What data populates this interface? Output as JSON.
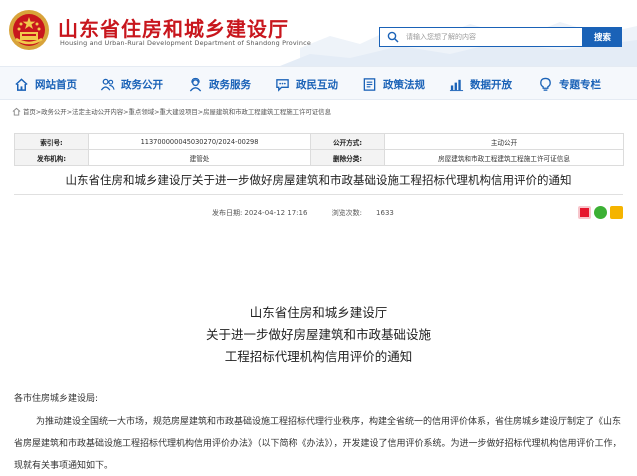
{
  "header": {
    "title": "山东省住房和城乡建设厅",
    "subtitle": "Housing and Urban-Rural Development Department of Shandong Province",
    "search_placeholder": "请输入您想了解的内容",
    "search_button": "搜索"
  },
  "nav": {
    "items": [
      {
        "label": "网站首页",
        "icon": "home-icon"
      },
      {
        "label": "政务公开",
        "icon": "people-icon"
      },
      {
        "label": "政务服务",
        "icon": "service-icon"
      },
      {
        "label": "政民互动",
        "icon": "chat-icon"
      },
      {
        "label": "政策法规",
        "icon": "law-icon"
      },
      {
        "label": "数据开放",
        "icon": "data-icon"
      },
      {
        "label": "专题专栏",
        "icon": "bulb-icon"
      }
    ]
  },
  "breadcrumb": {
    "text": "首页>政务公开>法定主动公开内容>重点领域>重大建设项目>房屋建筑和市政工程建筑工程施工许可证信息"
  },
  "meta": {
    "index_label": "索引号:",
    "index_value": "11370000004503027​0/2024-00298",
    "public_label": "公开方式:",
    "public_value": "主动公开",
    "org_label": "发布机构:",
    "org_value": "建管处",
    "category_label": "删除分类:",
    "category_value": "房屋建筑和市政工程建筑工程施工许可证信息"
  },
  "article": {
    "title": "山东省住房和城乡建设厅关于进一步做好房屋建筑和市政基础设施工程招标代理机构信用评价的通知",
    "date_label": "发布日期:",
    "date_value": "2024-04-12 17:16",
    "views_label": "浏览次数:",
    "views_value": "1633"
  },
  "doc": {
    "head1": "山东省住房和城乡建设厅",
    "head2": "关于进一步做好房屋建筑和市政基础设施",
    "head3": "工程招标代理机构信用评价的通知",
    "salutation": "各市住房城乡建设局:",
    "paragraph": "为推动建设全国统一大市场，规范房屋建筑和市政基础设施工程招标代理行业秩序，构建全省统一的信用评价体系，省住房城乡建设厅制定了《山东省房屋建筑和市政基础设施工程招标代理机构信用评价办法》（以下简称《办法》），开发建设了信用评价系统。为进一步做好招标代理机构信用评价工作，现就有关事项通知如下。"
  },
  "colors": {
    "brand_red": "#c8161d",
    "nav_blue": "#1a62b7"
  }
}
